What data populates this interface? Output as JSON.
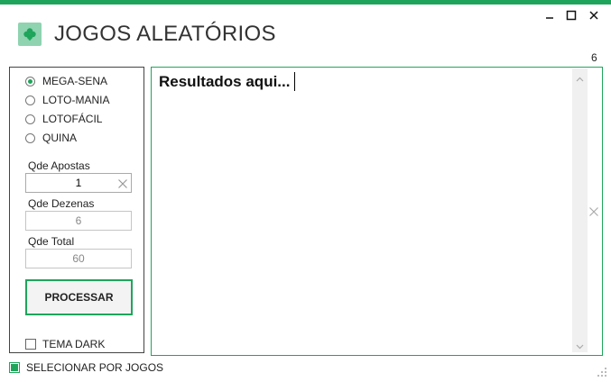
{
  "window": {
    "title": "JOGOS ALEATÓRIOS",
    "accent_color": "#1fa55b",
    "logo_icon": "clover-icon",
    "count": "6"
  },
  "lotteries": [
    {
      "label": "MEGA-SENA",
      "checked": true
    },
    {
      "label": "LOTO-MANIA",
      "checked": false
    },
    {
      "label": "LOTOFÁCIL",
      "checked": false
    },
    {
      "label": "QUINA",
      "checked": false
    }
  ],
  "fields": {
    "apostas": {
      "label": "Qde Apostas",
      "value": "1"
    },
    "dezenas": {
      "label": "Qde Dezenas",
      "value": "6"
    },
    "total": {
      "label": "Qde Total",
      "value": "60"
    }
  },
  "actions": {
    "process_label": "PROCESSAR"
  },
  "options": {
    "dark_theme_label": "TEMA DARK",
    "dark_theme_checked": false,
    "select_by_games_label": "SELECIONAR POR JOGOS",
    "select_by_games_checked": true
  },
  "results": {
    "placeholder": "Resultados aqui..."
  }
}
